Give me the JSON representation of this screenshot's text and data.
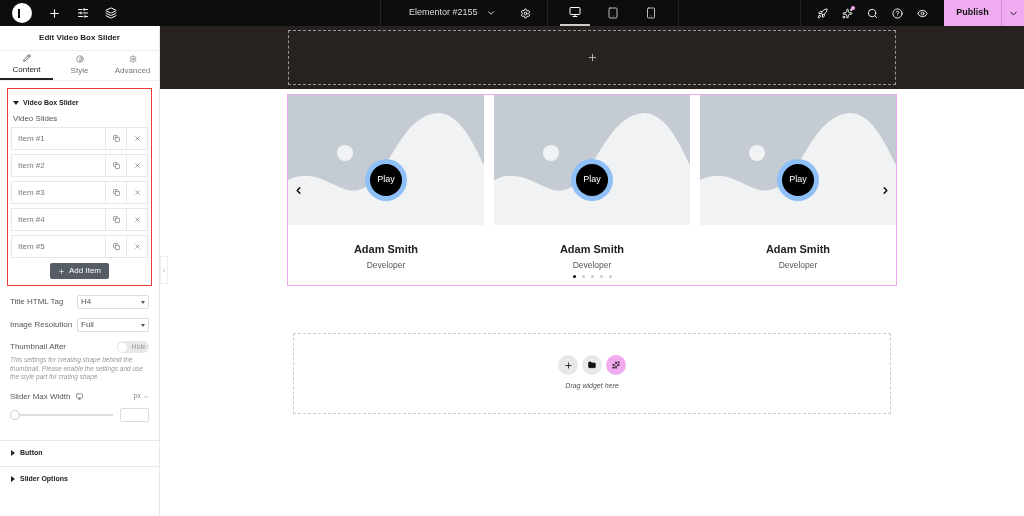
{
  "topbar": {
    "document": "Elementor #2155",
    "devices": [
      {
        "kind": "desktop",
        "selected": true
      },
      {
        "kind": "tablet",
        "selected": false
      },
      {
        "kind": "mobile",
        "selected": false
      }
    ],
    "publish": "Publish",
    "notification": true
  },
  "panel": {
    "title": "Edit Video Box Slider",
    "tabs": [
      {
        "label": "Content",
        "kind": "pencil",
        "selected": true
      },
      {
        "label": "Style",
        "kind": "contrast",
        "selected": false
      },
      {
        "label": "Advanced",
        "kind": "gear",
        "selected": false
      }
    ],
    "section": {
      "title": "Video Box Slider",
      "expanded": true,
      "label": "Video Slides",
      "items": [
        "Item #1",
        "Item #2",
        "Item #3",
        "Item #4",
        "Item #5"
      ],
      "add": "Add Item"
    },
    "fields": [
      {
        "kind": "select",
        "label": "Title HTML Tag",
        "value": "H4"
      },
      {
        "kind": "select",
        "label": "Image Resolution",
        "value": "Full"
      },
      {
        "kind": "toggle",
        "label": "Thumbnail After",
        "on": false,
        "off_label": "Hide"
      }
    ],
    "note": "This settings for creating shape behind the thumbnail, Please enable the settings and use the style part for crating shape.",
    "slider": {
      "label": "Slider Max Width",
      "unit": "px",
      "level": 0
    },
    "collapsed": [
      {
        "title": "Button",
        "expanded": false
      },
      {
        "title": "Slider Options",
        "expanded": false
      }
    ]
  },
  "canvas": {
    "slides": [
      {
        "play": "Play",
        "name": "Adam Smith",
        "role": "Developer"
      },
      {
        "play": "Play",
        "name": "Adam Smith",
        "role": "Developer"
      },
      {
        "play": "Play",
        "name": "Adam Smith",
        "role": "Developer"
      }
    ],
    "dots": [
      {
        "selected": true
      },
      {
        "selected": false
      },
      {
        "selected": false
      },
      {
        "selected": false
      },
      {
        "selected": false
      }
    ],
    "drop_hint": "Drag widget here"
  }
}
